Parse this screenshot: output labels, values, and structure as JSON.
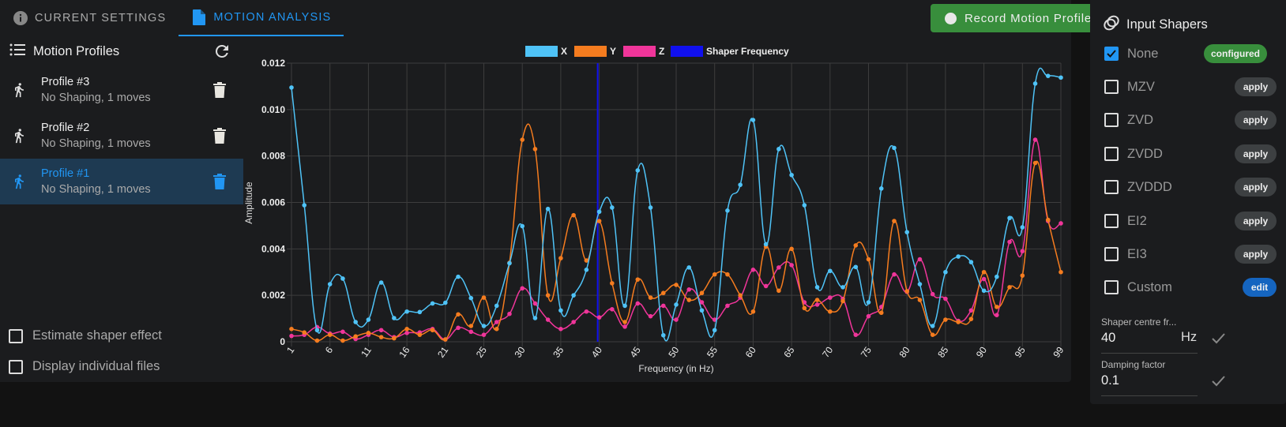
{
  "tabs": [
    {
      "label": "Current Settings",
      "icon": "info-icon",
      "active": false
    },
    {
      "label": "Motion Analysis",
      "icon": "file-icon",
      "active": true
    }
  ],
  "record_button": {
    "label": "Record Motion Profile",
    "icon": "record-dot-icon"
  },
  "profiles": {
    "title": "Motion Profiles",
    "items": [
      {
        "name": "Profile #3",
        "description": "No Shaping, 1 moves",
        "active": false
      },
      {
        "name": "Profile #2",
        "description": "No Shaping, 1 moves",
        "active": false
      },
      {
        "name": "Profile #1",
        "description": "No Shaping, 1 moves",
        "active": true
      }
    ]
  },
  "options": [
    {
      "label": "Estimate shaper effect",
      "checked": false
    },
    {
      "label": "Display individual files",
      "checked": false
    }
  ],
  "input_shapers": {
    "title": "Input Shapers",
    "items": [
      {
        "label": "None",
        "checked": true,
        "chip": "configured",
        "chip_type": "configured"
      },
      {
        "label": "MZV",
        "checked": false,
        "chip": "apply",
        "chip_type": "apply"
      },
      {
        "label": "ZVD",
        "checked": false,
        "chip": "apply",
        "chip_type": "apply"
      },
      {
        "label": "ZVDD",
        "checked": false,
        "chip": "apply",
        "chip_type": "apply"
      },
      {
        "label": "ZVDDD",
        "checked": false,
        "chip": "apply",
        "chip_type": "apply"
      },
      {
        "label": "EI2",
        "checked": false,
        "chip": "apply",
        "chip_type": "apply"
      },
      {
        "label": "EI3",
        "checked": false,
        "chip": "apply",
        "chip_type": "apply"
      },
      {
        "label": "Custom",
        "checked": false,
        "chip": "edit",
        "chip_type": "edit"
      }
    ],
    "centre_frequency": {
      "label": "Shaper centre fr...",
      "value": "40",
      "unit": "Hz"
    },
    "damping_factor": {
      "label": "Damping factor",
      "value": "0.1"
    }
  },
  "colors": {
    "x": "#4fc3f7",
    "y": "#f57c1f",
    "z": "#f0359a",
    "shaper": "#1010ee",
    "accent": "#2196f3",
    "green": "#388e3c"
  },
  "chart_data": {
    "type": "line",
    "xlabel": "Frequency (in Hz)",
    "ylabel": "Amplitude",
    "ylim": [
      0,
      0.012
    ],
    "yticks": [
      "0",
      "0.002",
      "0.004",
      "0.006",
      "0.008",
      "0.010",
      "0.012"
    ],
    "xtick_labels": [
      "1",
      "6",
      "11",
      "16",
      "21",
      "25",
      "30",
      "35",
      "40",
      "45",
      "50",
      "55",
      "60",
      "65",
      "70",
      "75",
      "80",
      "85",
      "90",
      "95",
      "99"
    ],
    "xlim": [
      1,
      99
    ],
    "num_points": 61,
    "grid": true,
    "legend": {
      "position": "top-center",
      "entries": [
        "X",
        "Y",
        "Z",
        "Shaper Frequency"
      ]
    },
    "shaper_frequency": 40,
    "series": [
      {
        "name": "X",
        "values": [
          0.01095,
          0.00588,
          0.0005,
          0.00248,
          0.00272,
          0.00085,
          0.00095,
          0.00255,
          0.00102,
          0.0013,
          0.00128,
          0.00165,
          0.00168,
          0.0028,
          0.00188,
          0.00068,
          0.00155,
          0.00338,
          0.00498,
          0.00102,
          0.00572,
          0.00135,
          0.002,
          0.0031,
          0.0056,
          0.00578,
          0.00155,
          0.00738,
          0.00578,
          0.00028,
          0.0016,
          0.0032,
          0.00135,
          0.0005,
          0.00565,
          0.00676,
          0.00955,
          0.0042,
          0.0083,
          0.00718,
          0.00588,
          0.00235,
          0.00305,
          0.00235,
          0.00322,
          0.0017,
          0.0066,
          0.00835,
          0.00472,
          0.00248,
          0.00068,
          0.003,
          0.00367,
          0.00343,
          0.0022,
          0.0028,
          0.00533,
          0.00493,
          0.01112,
          0.01145,
          0.01138
        ]
      },
      {
        "name": "Y",
        "values": [
          0.00055,
          0.0004,
          5e-05,
          0.0003,
          5e-05,
          0.00023,
          0.00038,
          0.0002,
          0.00015,
          0.00055,
          0.0003,
          0.0005,
          0.0001,
          0.00118,
          0.00068,
          0.0019,
          0.00055,
          0.0034,
          0.0087,
          0.0083,
          0.002,
          0.0036,
          0.00545,
          0.0035,
          0.0052,
          0.00252,
          0.00085,
          0.00268,
          0.0019,
          0.0021,
          0.00245,
          0.0018,
          0.0021,
          0.0029,
          0.0029,
          0.002,
          0.0013,
          0.0041,
          0.0022,
          0.004,
          0.00145,
          0.0018,
          0.0013,
          0.00175,
          0.00415,
          0.00355,
          0.00125,
          0.0052,
          0.00218,
          0.0018,
          0.0003,
          0.00095,
          0.00085,
          0.00098,
          0.003,
          0.0015,
          0.00235,
          0.00285,
          0.0077,
          0.00525,
          0.003
        ]
      },
      {
        "name": "Z",
        "values": [
          0.00025,
          0.0003,
          0.00063,
          0.00035,
          0.00043,
          0.00012,
          0.0003,
          0.0005,
          0.0002,
          0.00038,
          0.0004,
          0.00055,
          0.0001,
          0.0006,
          0.00043,
          0.0003,
          0.00085,
          0.0012,
          0.0023,
          0.00165,
          0.00095,
          0.00055,
          0.00085,
          0.0013,
          0.00105,
          0.0014,
          0.00065,
          0.00165,
          0.0011,
          0.00155,
          0.00095,
          0.00225,
          0.0017,
          0.00095,
          0.00155,
          0.0019,
          0.0031,
          0.0024,
          0.0032,
          0.0033,
          0.0017,
          0.0016,
          0.0019,
          0.00185,
          0.0003,
          0.0011,
          0.0015,
          0.0029,
          0.00215,
          0.00355,
          0.00205,
          0.00185,
          0.0009,
          0.00135,
          0.0027,
          0.00115,
          0.0043,
          0.0039,
          0.0087,
          0.0052,
          0.0051
        ]
      }
    ]
  }
}
